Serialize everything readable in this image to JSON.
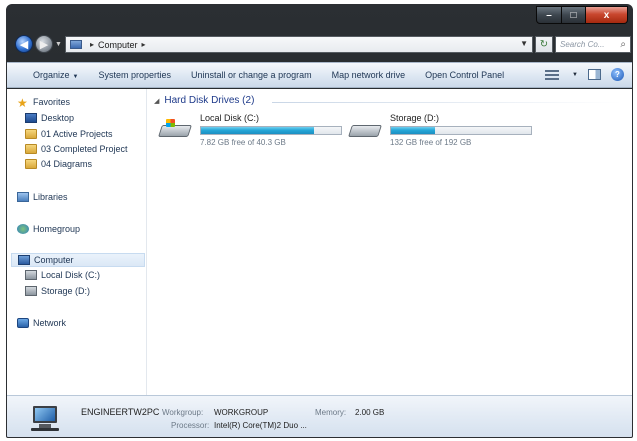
{
  "window": {
    "caption_buttons": {
      "minimize": "–",
      "maximize": "□",
      "close": "x"
    }
  },
  "navigation": {
    "back_icon": "arrow-left-icon",
    "forward_icon": "arrow-right-icon",
    "breadcrumb": [
      "Computer"
    ],
    "search_placeholder": "Search Co...",
    "refresh_glyph": "↻"
  },
  "toolbar": {
    "items": [
      "Organize",
      "System properties",
      "Uninstall or change a program",
      "Map network drive",
      "Open Control Panel"
    ]
  },
  "sidebar": {
    "favorites": "Favorites",
    "desktop": "Desktop",
    "folder1": "01 Active Projects",
    "folder2": "03 Completed Project",
    "folder3": "04 Diagrams",
    "libraries": "Libraries",
    "homegroup": "Homegroup",
    "computer": "Computer",
    "local_disk": "Local Disk (C:)",
    "storage": "Storage (D:)",
    "network": "Network"
  },
  "main": {
    "group_title": "Hard Disk Drives (2)",
    "drives": [
      {
        "name": "Local Disk (C:)",
        "free_text": "7.82 GB free of 40.3 GB",
        "used_fraction": 0.806
      },
      {
        "name": "Storage (D:)",
        "free_text": "132 GB free of 192 GB",
        "used_fraction": 0.3125
      }
    ]
  },
  "details": {
    "computer_name": "ENGINEERTW2PC",
    "workgroup_label": "Workgroup:",
    "workgroup_value": "WORKGROUP",
    "memory_label": "Memory:",
    "memory_value": "2.00 GB",
    "processor_label": "Processor:",
    "processor_value": "Intel(R) Core(TM)2 Duo ..."
  },
  "colors": {
    "accent_bar": "#26a7d8",
    "frame": "#25292c",
    "link_text": "#1e3553"
  }
}
